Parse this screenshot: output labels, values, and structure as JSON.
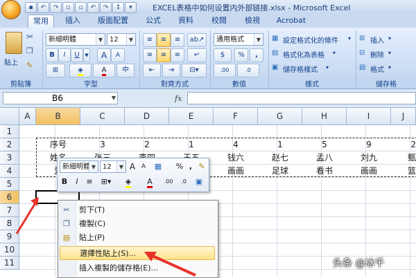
{
  "window": {
    "title": "EXCEL表格中如何设置内外部链接.xlsx - Microsoft Excel"
  },
  "ribbon": {
    "tabs": [
      "常用",
      "插入",
      "版面配置",
      "公式",
      "資料",
      "校閱",
      "檢視",
      "Acrobat"
    ],
    "active_tab": "常用",
    "clipboard": {
      "paste_label": "貼上",
      "group_label": "剪貼簿"
    },
    "font": {
      "name": "新細明體",
      "size": "12",
      "group_label": "字型",
      "bold": "B",
      "italic": "I",
      "underline": "U",
      "grow": "A",
      "shrink": "A"
    },
    "alignment": {
      "group_label": "對齊方式"
    },
    "number": {
      "format": "通用格式",
      "currency": "$",
      "percent": "%",
      "comma": ",",
      "group_label": "數值"
    },
    "styles": {
      "conditional": "設定格式化的條件",
      "as_table": "格式化為表格",
      "cell_styles": "儲存格樣式",
      "group_label": "樣式"
    },
    "cells": {
      "insert": "插入",
      "delete": "刪除",
      "format": "格式",
      "group_label": "儲存格"
    }
  },
  "formula_bar": {
    "name_box": "B6",
    "fx": "fx",
    "content": ""
  },
  "grid": {
    "columns": [
      "A",
      "B",
      "C",
      "D",
      "E",
      "F",
      "G",
      "H",
      "I",
      "J"
    ],
    "rows": [
      "1",
      "2",
      "3",
      "4",
      "5",
      "6",
      "7",
      "8",
      "9",
      "10",
      "11"
    ],
    "selected_column": "B",
    "selected_row": "6",
    "row2": [
      "序号",
      "3",
      "2",
      "1",
      "4",
      "1",
      "5",
      "9",
      "2"
    ],
    "row3": [
      "姓名",
      "张三",
      "李四",
      "王五",
      "钱六",
      "赵七",
      "孟八",
      "刘九",
      "甄"
    ],
    "row4": [
      "爱",
      "",
      "",
      "",
      "画画",
      "足球",
      "看书",
      "画画",
      "篮"
    ]
  },
  "mini_toolbar": {
    "font": "新細明體",
    "size": "12",
    "grow": "A",
    "shrink": "A",
    "percent": "%",
    "comma": ",",
    "bold": "B",
    "italic": "I",
    "align": "≡",
    "font_color": "A"
  },
  "context_menu": {
    "items": [
      {
        "label": "剪下(T)",
        "icon": "scissors-icon"
      },
      {
        "label": "複製(C)",
        "icon": "copy-icon"
      },
      {
        "label": "貼上(P)",
        "icon": "paste-icon"
      },
      {
        "label": "選擇性貼上(S)...",
        "icon": ""
      },
      {
        "label": "插入複製的儲存格(E)...",
        "icon": ""
      }
    ],
    "highlighted_index": 3
  },
  "watermark": "头条 @冰千",
  "colors": {
    "ribbon": "#c8dbf2",
    "highlight": "#ffe28a",
    "arrow": "#e8312b",
    "selected_header": "#f1c15f"
  }
}
